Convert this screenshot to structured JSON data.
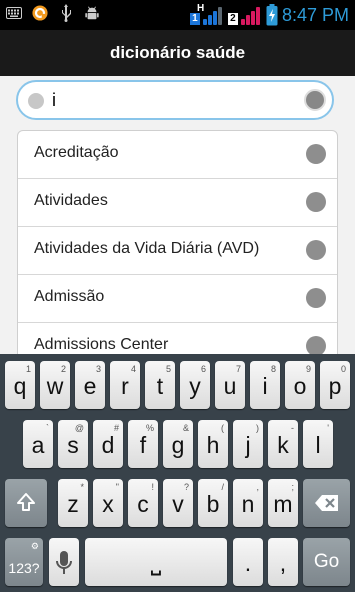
{
  "status_bar": {
    "icons": [
      "keyboard-icon",
      "orange-app-icon",
      "usb-icon",
      "android-debug-icon"
    ],
    "sim2_label": "2",
    "network_label": "1",
    "network_type": "H",
    "time": "8:47 PM",
    "colors": {
      "clock": "#2e9bd8",
      "signal1": "#1c75d8",
      "signal2": "#d8195f"
    }
  },
  "header": {
    "title": "dicionário saúde"
  },
  "search": {
    "value": "i"
  },
  "results": [
    {
      "label": "Acreditação"
    },
    {
      "label": "Atividades"
    },
    {
      "label": "Atividades da Vida Diária (AVD)"
    },
    {
      "label": "Admissão"
    },
    {
      "label": "Admissions Center"
    }
  ],
  "keyboard": {
    "row1": [
      {
        "key": "q",
        "hint": "1"
      },
      {
        "key": "w",
        "hint": "2"
      },
      {
        "key": "e",
        "hint": "3"
      },
      {
        "key": "r",
        "hint": "4"
      },
      {
        "key": "t",
        "hint": "5"
      },
      {
        "key": "y",
        "hint": "6"
      },
      {
        "key": "u",
        "hint": "7"
      },
      {
        "key": "i",
        "hint": "8"
      },
      {
        "key": "o",
        "hint": "9"
      },
      {
        "key": "p",
        "hint": "0"
      }
    ],
    "row2": [
      {
        "key": "a",
        "hint": "`"
      },
      {
        "key": "s",
        "hint": "@"
      },
      {
        "key": "d",
        "hint": "#"
      },
      {
        "key": "f",
        "hint": "%"
      },
      {
        "key": "g",
        "hint": "&"
      },
      {
        "key": "h",
        "hint": "("
      },
      {
        "key": "j",
        "hint": ")"
      },
      {
        "key": "k",
        "hint": "-"
      },
      {
        "key": "l",
        "hint": "'"
      }
    ],
    "row3": [
      {
        "key": "z",
        "hint": "*"
      },
      {
        "key": "x",
        "hint": "\""
      },
      {
        "key": "c",
        "hint": "!"
      },
      {
        "key": "v",
        "hint": "?"
      },
      {
        "key": "b",
        "hint": "/"
      },
      {
        "key": "n",
        "hint": ","
      },
      {
        "key": "m",
        "hint": ";"
      }
    ],
    "symbols_label": "123?",
    "settings_hint": "⚙",
    "space_glyph": "⎵",
    "period": ".",
    "comma": ",",
    "go_label": "Go"
  }
}
